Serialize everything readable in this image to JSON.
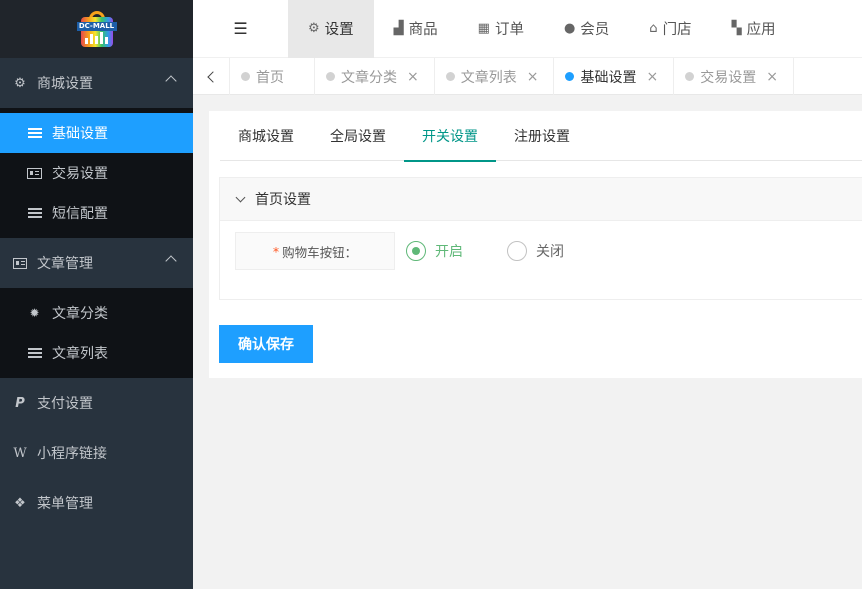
{
  "app": {
    "logo_text": "DC-MALL"
  },
  "sidebar": {
    "groups": [
      {
        "label": "商城设置",
        "expanded": true,
        "items": [
          {
            "label": "基础设置",
            "active": true
          },
          {
            "label": "交易设置"
          },
          {
            "label": "短信配置"
          }
        ]
      },
      {
        "label": "文章管理",
        "expanded": true,
        "items": [
          {
            "label": "文章分类"
          },
          {
            "label": "文章列表"
          }
        ]
      },
      {
        "label": "支付设置"
      },
      {
        "label": "小程序链接"
      },
      {
        "label": "菜单管理"
      }
    ]
  },
  "topnav": {
    "items": [
      {
        "label": "设置",
        "icon": "gears-icon",
        "active": true
      },
      {
        "label": "商品",
        "icon": "shopping-bag-icon"
      },
      {
        "label": "订单",
        "icon": "table-icon"
      },
      {
        "label": "会员",
        "icon": "user-icon"
      },
      {
        "label": "门店",
        "icon": "bank-icon"
      },
      {
        "label": "应用",
        "icon": "grid-icon"
      }
    ]
  },
  "tabs": [
    {
      "label": "首页"
    },
    {
      "label": "文章分类"
    },
    {
      "label": "文章列表"
    },
    {
      "label": "基础设置",
      "active": true
    },
    {
      "label": "交易设置"
    }
  ],
  "settings": {
    "subtabs": [
      "商城设置",
      "全局设置",
      "开关设置",
      "注册设置"
    ],
    "active_subtab": "开关设置",
    "panel_title": "首页设置",
    "field_label": "购物车按钮：",
    "required_mark": "*",
    "options": [
      {
        "label": "开启",
        "checked": true
      },
      {
        "label": "关闭",
        "checked": false
      }
    ],
    "save_label": "确认保存"
  },
  "colors": {
    "accent": "#1e9fff",
    "active_tab": "#009688",
    "radio_on": "#5fb878",
    "sidebar": "#28333e"
  }
}
